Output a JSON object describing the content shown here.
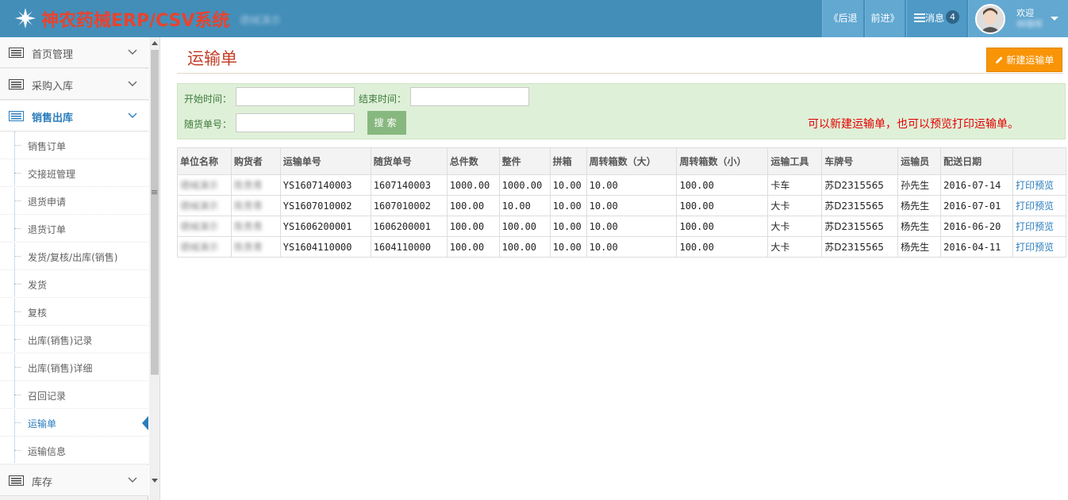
{
  "header": {
    "brand": "神农药械ERP/CSV系统",
    "brand_sub": "德械演示",
    "back_label": "《后退",
    "forward_label": "前进》",
    "messages_label": "消息",
    "messages_count": "4",
    "welcome_label": "欢迎",
    "username": "林晓晖"
  },
  "sidebar": {
    "menus": [
      {
        "label": "首页管理"
      },
      {
        "label": "采购入库"
      },
      {
        "label": "销售出库"
      },
      {
        "label": "库存"
      }
    ],
    "sub_items": [
      {
        "label": "销售订单"
      },
      {
        "label": "交接班管理"
      },
      {
        "label": "退货申请"
      },
      {
        "label": "退货订单"
      },
      {
        "label": "发货/复核/出库(销售)"
      },
      {
        "label": "发货"
      },
      {
        "label": "复核"
      },
      {
        "label": "出库(销售)记录"
      },
      {
        "label": "出库(销售)详细"
      },
      {
        "label": "召回记录"
      },
      {
        "label": "运输单"
      },
      {
        "label": "运输信息"
      }
    ]
  },
  "main": {
    "title": "运输单",
    "new_button": "新建运输单",
    "filters": {
      "start_label": "开始时间：",
      "end_label": "结束时间：",
      "waybill_label": "随货单号：",
      "search_button": "搜索"
    },
    "hint": "可以新建运输单，也可以预览打印运输单。",
    "table": {
      "headers": [
        "单位名称",
        "购货者",
        "运输单号",
        "随货单号",
        "总件数",
        "整件",
        "拼箱",
        "周转箱数（大）",
        "周转箱数（小）",
        "运输工具",
        "车牌号",
        "运输员",
        "配送日期",
        ""
      ],
      "rows": [
        [
          "德械演示",
          "陈贵青",
          "YS1607140003",
          "1607140003",
          "1000.00",
          "1000.00",
          "10.00",
          "10.00",
          "100.00",
          "卡车",
          "苏D2315565",
          "孙先生",
          "2016-07-14",
          "打印预览"
        ],
        [
          "德械演示",
          "陈贵青",
          "YS1607010002",
          "1607010002",
          "100.00",
          "10.00",
          "10.00",
          "10.00",
          "100.00",
          "大卡",
          "苏D2315565",
          "杨先生",
          "2016-07-01",
          "打印预览"
        ],
        [
          "德械演示",
          "陈贵青",
          "YS1606200001",
          "1606200001",
          "100.00",
          "100.00",
          "10.00",
          "10.00",
          "100.00",
          "大卡",
          "苏D2315565",
          "杨先生",
          "2016-06-20",
          "打印预览"
        ],
        [
          "德械演示",
          "陈贵青",
          "YS1604110000",
          "1604110000",
          "100.00",
          "100.00",
          "10.00",
          "10.00",
          "100.00",
          "大卡",
          "苏D2315565",
          "杨先生",
          "2016-04-11",
          "打印预览"
        ]
      ]
    }
  }
}
